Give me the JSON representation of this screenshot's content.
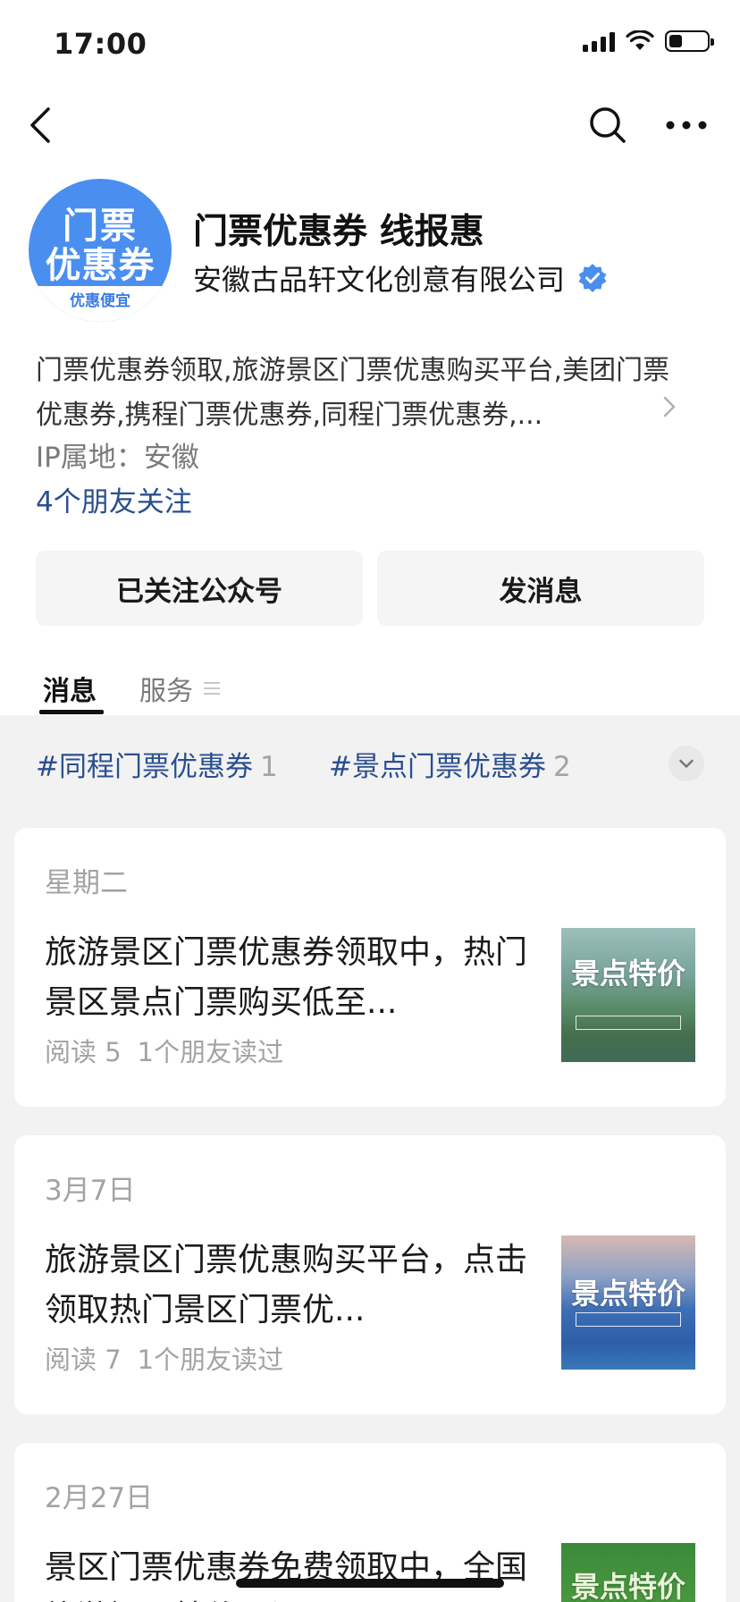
{
  "status_bar": {
    "time": "17:00"
  },
  "nav": {
    "icons": [
      "chevron-left-icon",
      "search-icon",
      "more-horizontal-icon"
    ]
  },
  "profile": {
    "avatar_line_1": "门票",
    "avatar_line_2": "优惠券",
    "avatar_tagline": "优惠便宜",
    "name": "门票优惠券 线报惠",
    "organization": "安徽古品轩文化创意有限公司",
    "description": "门票优惠券领取,旅游景区门票优惠购买平台,美团门票优惠券,携程门票优惠券,同程门票优惠券,...",
    "ip_location": "IP属地：安徽",
    "friends_follow": "4个朋友关注",
    "verified_color": "#4a8ef0"
  },
  "actions": {
    "followed_label": "已关注公众号",
    "message_label": "发消息"
  },
  "tabs": [
    {
      "label": "消息",
      "active": true
    },
    {
      "label": "服务",
      "active": false
    }
  ],
  "tags": [
    {
      "label": "#同程门票优惠券",
      "count": "1"
    },
    {
      "label": "#景点门票优惠券",
      "count": "2"
    }
  ],
  "articles": [
    {
      "date": "星期二",
      "title": "旅游景区门票优惠券领取中，热门景区景点门票购买低至...",
      "reads": "阅读 5",
      "friends": "1个朋友读过",
      "thumb_text": "景点特价"
    },
    {
      "date": "3月7日",
      "title": "旅游景区门票优惠购买平台，点击领取热门景区门票优...",
      "reads": "阅读 7",
      "friends": "1个朋友读过",
      "thumb_text": "景点特价"
    },
    {
      "date": "2月27日",
      "title": "景区门票优惠券免费领取中，全国旅游门票特价预订...",
      "reads": "",
      "friends": "",
      "thumb_text": "景点特价"
    }
  ],
  "colors": {
    "link_blue": "#2a4f8f",
    "feed_background": "#f2f2f2",
    "muted_text": "#a3a3a3"
  }
}
